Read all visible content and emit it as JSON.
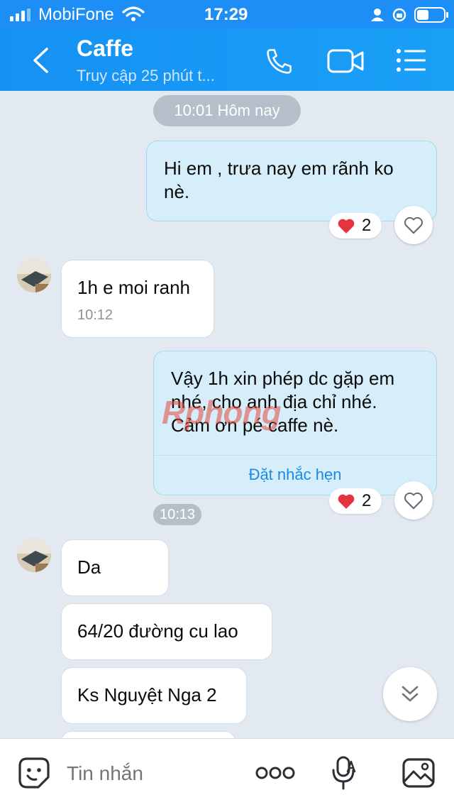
{
  "status_bar": {
    "carrier": "MobiFone",
    "time": "17:29"
  },
  "header": {
    "title": "Caffe",
    "subtitle": "Truy cập 25 phút t..."
  },
  "messages": {
    "date_divider": "10:01 Hôm nay",
    "out_1": {
      "text": "Hi em , trưa nay em rãnh ko nè.",
      "reaction_count": "2"
    },
    "in_1": {
      "text": "1h e moi ranh",
      "time": "10:12"
    },
    "out_2": {
      "text": "Vậy 1h xin phép dc gặp em nhé, cho anh địa chỉ nhé. Cảm ơn pé caffe nè.",
      "action": "Đặt nhắc hẹn",
      "reaction_count": "2",
      "time": "10:13"
    },
    "in_2": "Da",
    "in_3": "64/20 đường cu lao",
    "in_4": "Ks Nguyệt Nga 2"
  },
  "watermark": "Rphong",
  "composer": {
    "placeholder": "Tin nhắn"
  },
  "colors": {
    "header_blue": "#1591f4",
    "outgoing_bubble": "#d5eef9",
    "link_blue": "#1a8ae6",
    "background": "#e2e9f1"
  }
}
